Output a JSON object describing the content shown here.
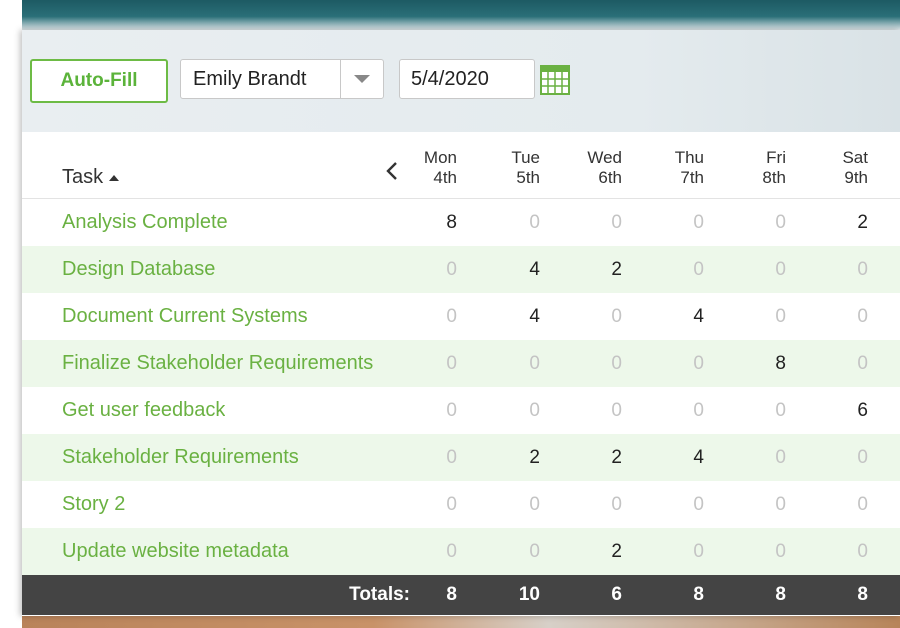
{
  "toolbar": {
    "autofill_label": "Auto-Fill",
    "employee_selected": "Emily Brandt",
    "date_value": "5/4/2020"
  },
  "table": {
    "task_header": "Task",
    "days": [
      {
        "dow": "Mon",
        "date": "4th"
      },
      {
        "dow": "Tue",
        "date": "5th"
      },
      {
        "dow": "Wed",
        "date": "6th"
      },
      {
        "dow": "Thu",
        "date": "7th"
      },
      {
        "dow": "Fri",
        "date": "8th"
      },
      {
        "dow": "Sat",
        "date": "9th"
      }
    ],
    "rows": [
      {
        "task": "Analysis Complete",
        "hours": [
          8,
          0,
          0,
          0,
          0,
          2
        ]
      },
      {
        "task": "Design Database",
        "hours": [
          0,
          4,
          2,
          0,
          0,
          0
        ]
      },
      {
        "task": "Document Current Systems",
        "hours": [
          0,
          4,
          0,
          4,
          0,
          0
        ]
      },
      {
        "task": "Finalize Stakeholder Requirements",
        "hours": [
          0,
          0,
          0,
          0,
          8,
          0
        ]
      },
      {
        "task": "Get user feedback",
        "hours": [
          0,
          0,
          0,
          0,
          0,
          6
        ]
      },
      {
        "task": "Stakeholder Requirements",
        "hours": [
          0,
          2,
          2,
          4,
          0,
          0
        ]
      },
      {
        "task": "Story 2",
        "hours": [
          0,
          0,
          0,
          0,
          0,
          0
        ]
      },
      {
        "task": "Update website metadata",
        "hours": [
          0,
          0,
          2,
          0,
          0,
          0
        ]
      }
    ],
    "totals_label": "Totals:",
    "totals": [
      8,
      10,
      6,
      8,
      8,
      8
    ]
  },
  "colors": {
    "accent_green": "#6ab142",
    "alt_row": "#edf8ea",
    "totals_bar": "#444444"
  },
  "icons": {
    "select_arrow": "chevron-down-icon",
    "calendar": "calendar-icon",
    "prev_week": "chevron-left-icon",
    "sort": "sort-ascending-icon"
  }
}
